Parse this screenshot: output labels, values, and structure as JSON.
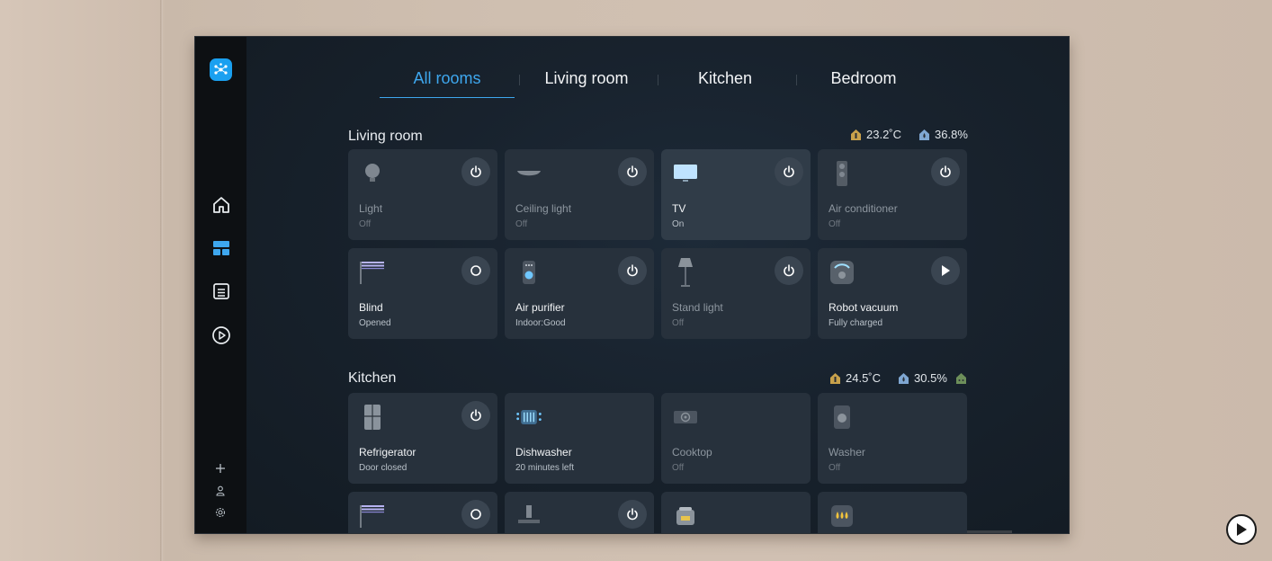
{
  "tabs": [
    "All rooms",
    "Living room",
    "Kitchen",
    "Bedroom"
  ],
  "sections": [
    {
      "title": "Living room",
      "temperature": "23.2˚C",
      "humidity": "36.8%",
      "devices": [
        {
          "name": "Light",
          "status": "Off",
          "control": "power",
          "icon": "bulb-icon",
          "state": "off"
        },
        {
          "name": "Ceiling light",
          "status": "Off",
          "control": "power",
          "icon": "ceiling-light-icon",
          "state": "off"
        },
        {
          "name": "TV",
          "status": "On",
          "control": "power",
          "icon": "tv-icon",
          "state": "on"
        },
        {
          "name": "Air conditioner",
          "status": "Off",
          "control": "power",
          "icon": "air-conditioner-icon",
          "state": "off"
        },
        {
          "name": "Blind",
          "status": "Opened",
          "control": "circle",
          "icon": "blind-icon",
          "state": "active"
        },
        {
          "name": "Air purifier",
          "status": "Indoor:Good",
          "control": "power",
          "icon": "air-purifier-icon",
          "state": "active"
        },
        {
          "name": "Stand light",
          "status": "Off",
          "control": "power",
          "icon": "stand-light-icon",
          "state": "off"
        },
        {
          "name": "Robot vacuum",
          "status": "Fully charged",
          "control": "play",
          "icon": "robot-vacuum-icon",
          "state": "active"
        }
      ]
    },
    {
      "title": "Kitchen",
      "temperature": "24.5˚C",
      "humidity": "30.5%",
      "devices": [
        {
          "name": "Refrigerator",
          "status": "Door closed",
          "control": "power",
          "icon": "refrigerator-icon",
          "state": "active"
        },
        {
          "name": "Dishwasher",
          "status": "20 minutes left",
          "control": "none",
          "icon": "dishwasher-icon",
          "state": "active"
        },
        {
          "name": "Cooktop",
          "status": "Off",
          "control": "none",
          "icon": "cooktop-icon",
          "state": "off"
        },
        {
          "name": "Washer",
          "status": "Off",
          "control": "none",
          "icon": "washer-icon",
          "state": "off"
        },
        {
          "name": "",
          "status": "",
          "control": "circle",
          "icon": "blind-icon",
          "state": "active"
        },
        {
          "name": "",
          "status": "",
          "control": "power",
          "icon": "hood-icon",
          "state": "active"
        },
        {
          "name": "",
          "status": "",
          "control": "none",
          "icon": "rice-cooker-icon",
          "state": "active"
        },
        {
          "name": "",
          "status": "",
          "control": "none",
          "icon": "oil-icon",
          "state": "active"
        }
      ]
    }
  ],
  "colors": {
    "accent": "#3ea7ee",
    "card": "#27313c",
    "card_on": "#303c48",
    "sidebar": "#0d1013"
  }
}
